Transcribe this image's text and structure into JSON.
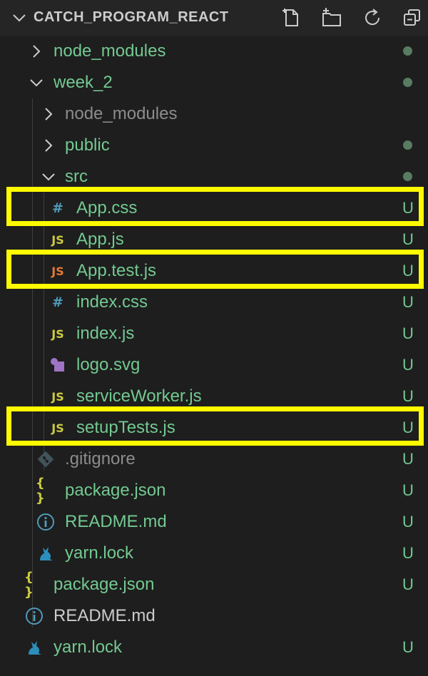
{
  "header": {
    "title": "CATCH_PROGRAM_REACT",
    "actions": [
      "new-file-icon",
      "new-folder-icon",
      "refresh-icon",
      "collapse-all-icon"
    ]
  },
  "colors": {
    "green": "#73c991",
    "grey": "#8c8c8c",
    "white": "#cccccc",
    "highlight": "#fffa00",
    "css_icon": "#519aba",
    "js_icon": "#cbcb41",
    "test_icon": "#e37933",
    "svg_icon": "#a074c4"
  },
  "tree": {
    "items": [
      {
        "label": "node_modules",
        "status": "dot"
      },
      {
        "label": "week_2",
        "status": "dot"
      },
      {
        "label": "node_modules",
        "status": ""
      },
      {
        "label": "public",
        "status": "dot"
      },
      {
        "label": "src",
        "status": "dot"
      },
      {
        "label": "App.css",
        "status": "U",
        "icon_text": "#"
      },
      {
        "label": "App.js",
        "status": "U",
        "icon_text": "JS"
      },
      {
        "label": "App.test.js",
        "status": "U",
        "icon_text": "JS"
      },
      {
        "label": "index.css",
        "status": "U",
        "icon_text": "#"
      },
      {
        "label": "index.js",
        "status": "U",
        "icon_text": "JS"
      },
      {
        "label": "logo.svg",
        "status": "U"
      },
      {
        "label": "serviceWorker.js",
        "status": "U",
        "icon_text": "JS"
      },
      {
        "label": "setupTests.js",
        "status": "U",
        "icon_text": "JS"
      },
      {
        "label": ".gitignore",
        "status": "U"
      },
      {
        "label": "package.json",
        "status": "U",
        "icon_text": "{ }"
      },
      {
        "label": "README.md",
        "status": "U"
      },
      {
        "label": "yarn.lock",
        "status": "U"
      },
      {
        "label": "package.json",
        "status": "U",
        "icon_text": "{ }"
      },
      {
        "label": "README.md",
        "status": ""
      },
      {
        "label": "yarn.lock",
        "status": "U"
      }
    ]
  }
}
